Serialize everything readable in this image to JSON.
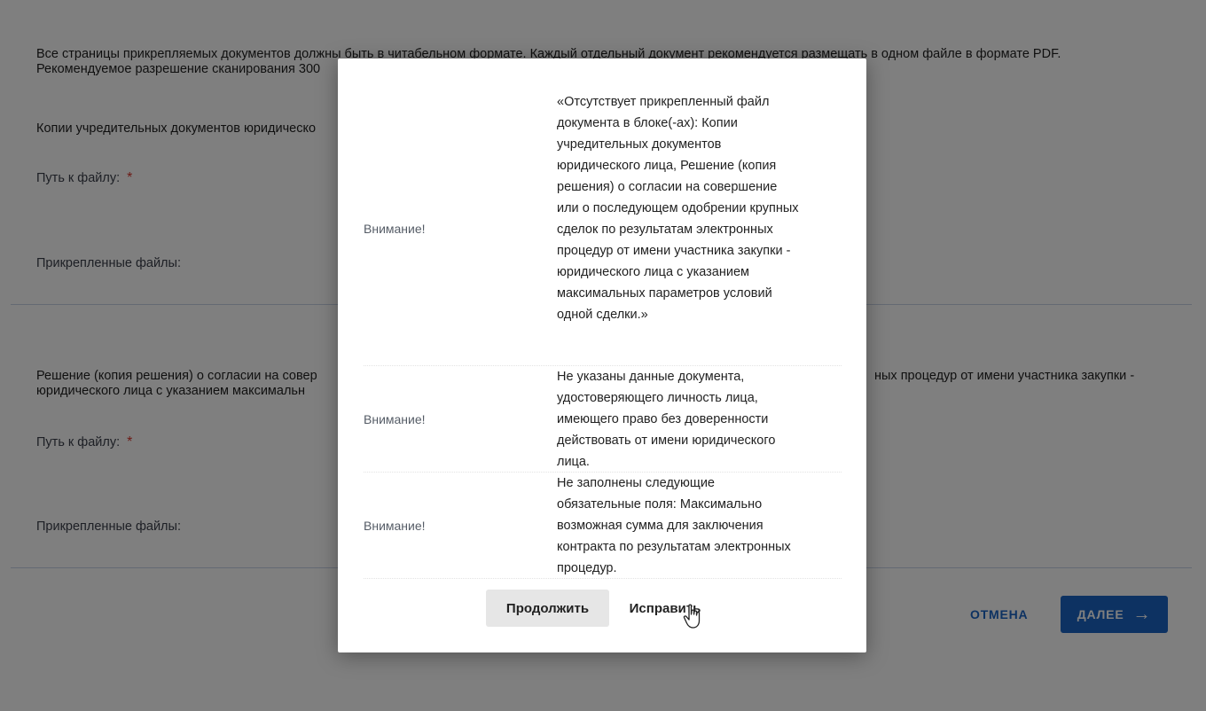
{
  "background": {
    "section1": {
      "info_line1": "Все страницы прикрепляемых документов должны быть в читабельном формате. Каждый отдельный документ рекомендуется размещать в одном файле в формате PDF.",
      "info_line2": "Рекомендуемое разрешение сканирования 300",
      "doc_title": "Копии учредительных документов юридическо",
      "file_path_label": "Путь к файлу:",
      "attached_label": "Прикрепленные файлы:"
    },
    "section2": {
      "doc_title_line1_left": "Решение (копия решения) о согласии на совер",
      "doc_title_line1_right": "ных процедур от имени участника закупки -",
      "doc_title_line2": "юридического лица с указанием максимальн",
      "file_path_label": "Путь к файлу:",
      "attached_label": "Прикрепленные файлы:"
    },
    "required_mark": "*",
    "cancel_label": "ОТМЕНА",
    "next_label": "ДАЛЕЕ"
  },
  "modal": {
    "messages": [
      {
        "label": "Внимание!",
        "text": "«Отсутствует прикрепленный файл документа в блоке(-ах): Копии учредительных документов юридического лица, Решение (копия решения) о согласии на совершение или о последующем одобрении крупных сделок по результатам электронных процедур от имени участника закупки - юридического лица с указанием максимальных параметров условий одной сделки.»"
      },
      {
        "label": "Внимание!",
        "text": "Не указаны данные документа, удостоверяющего личность лица, имеющего право без доверенности действовать от имени юридического лица."
      },
      {
        "label": "Внимание!",
        "text": "Не заполнены следующие обязательные поля: Максимально возможная сумма для заключения контракта по результатам электронных процедур."
      }
    ],
    "continue_label": "Продолжить",
    "fix_label": "Исправить"
  },
  "colors": {
    "primary": "#1b64c4",
    "required": "#d9342b",
    "overlay": "rgba(0,0,0,0.5)"
  }
}
